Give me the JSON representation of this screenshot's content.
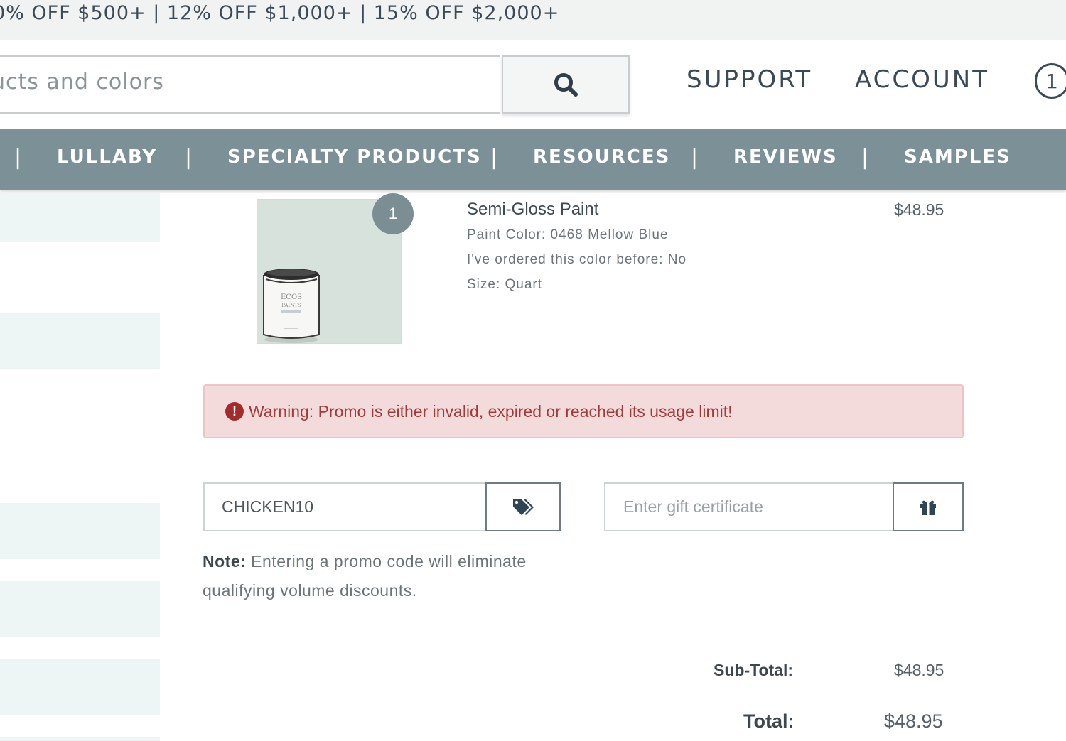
{
  "promo_banner": {
    "text": "0% OFF $500+ | 12% OFF $1,000+ | 15% OFF $2,000+"
  },
  "header": {
    "search": {
      "placeholder": "ucts and colors",
      "button_icon": "search-icon"
    },
    "nav": {
      "support": "SUPPORT",
      "account": "ACCOUNT"
    },
    "cart_count": "1"
  },
  "category_nav": {
    "separator": "|",
    "items": [
      "LULLABY",
      "SPECIALTY PRODUCTS",
      "RESOURCES",
      "REVIEWS",
      "SAMPLES"
    ]
  },
  "cart_item": {
    "quantity": "1",
    "name": "Semi-Gloss Paint",
    "details": [
      "Paint Color: 0468 Mellow Blue",
      "I've ordered this color before: No",
      "Size: Quart"
    ],
    "price": "$48.95",
    "image_label": [
      "ECOS",
      "PAINTS"
    ]
  },
  "warning": {
    "icon": "exclamation-circle-icon",
    "text": "Warning: Promo is either invalid, expired or reached its usage limit!"
  },
  "promo_code": {
    "value": "CHICKEN10",
    "button_icon": "tags-icon"
  },
  "gift_certificate": {
    "placeholder": "Enter gift certificate",
    "button_icon": "gift-icon"
  },
  "note": {
    "label": "Note:",
    "text": "Entering a promo code will eliminate qualifying volume discounts."
  },
  "totals": {
    "subtotal_label": "Sub-Total:",
    "subtotal_value": "$48.95",
    "total_label": "Total:",
    "total_value": "$48.95"
  },
  "colors": {
    "category_bar": "#7b9097",
    "text_dark": "#3b4a56",
    "warning_bg": "#f3dbdc",
    "warning_text": "#a33a3a",
    "sidebar_block": "#eef5f5"
  }
}
